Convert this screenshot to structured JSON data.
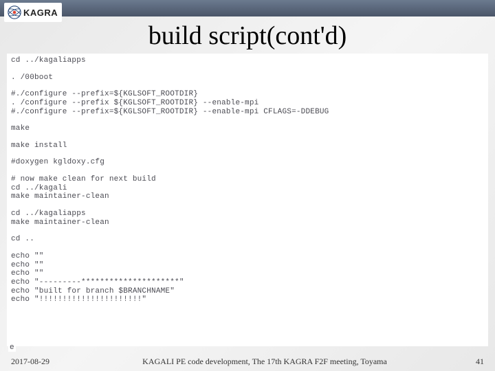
{
  "logo": {
    "text": "KAGRA"
  },
  "title": "build script(cont'd)",
  "code": {
    "lines": [
      "cd ../kagaliapps",
      "",
      ". /00boot",
      "",
      "#./configure --prefix=${KGLSOFT_ROOTDIR}",
      ". /configure --prefix ${KGLSOFT_ROOTDIR} --enable-mpi",
      "#./configure --prefix=${KGLSOFT_ROOTDIR} --enable-mpi CFLAGS=-DDEBUG",
      "",
      "make",
      "",
      "make install",
      "",
      "#doxygen kgldoxy.cfg",
      "",
      "# now make clean for next build",
      "cd ../kagali",
      "make maintainer-clean",
      "",
      "cd ../kagaliapps",
      "make maintainer-clean",
      "",
      "cd ..",
      "",
      "echo \"\"",
      "echo \"\"",
      "echo \"\"",
      "echo \"---------*********************\"",
      "echo \"built for branch $BRANCHNAME\"",
      "echo \"!!!!!!!!!!!!!!!!!!!!!!\""
    ],
    "stray": "e"
  },
  "footer": {
    "date": "2017-08-29",
    "center": "KAGALI PE code development, The 17th KAGRA F2F meeting, Toyama",
    "page": "41"
  }
}
